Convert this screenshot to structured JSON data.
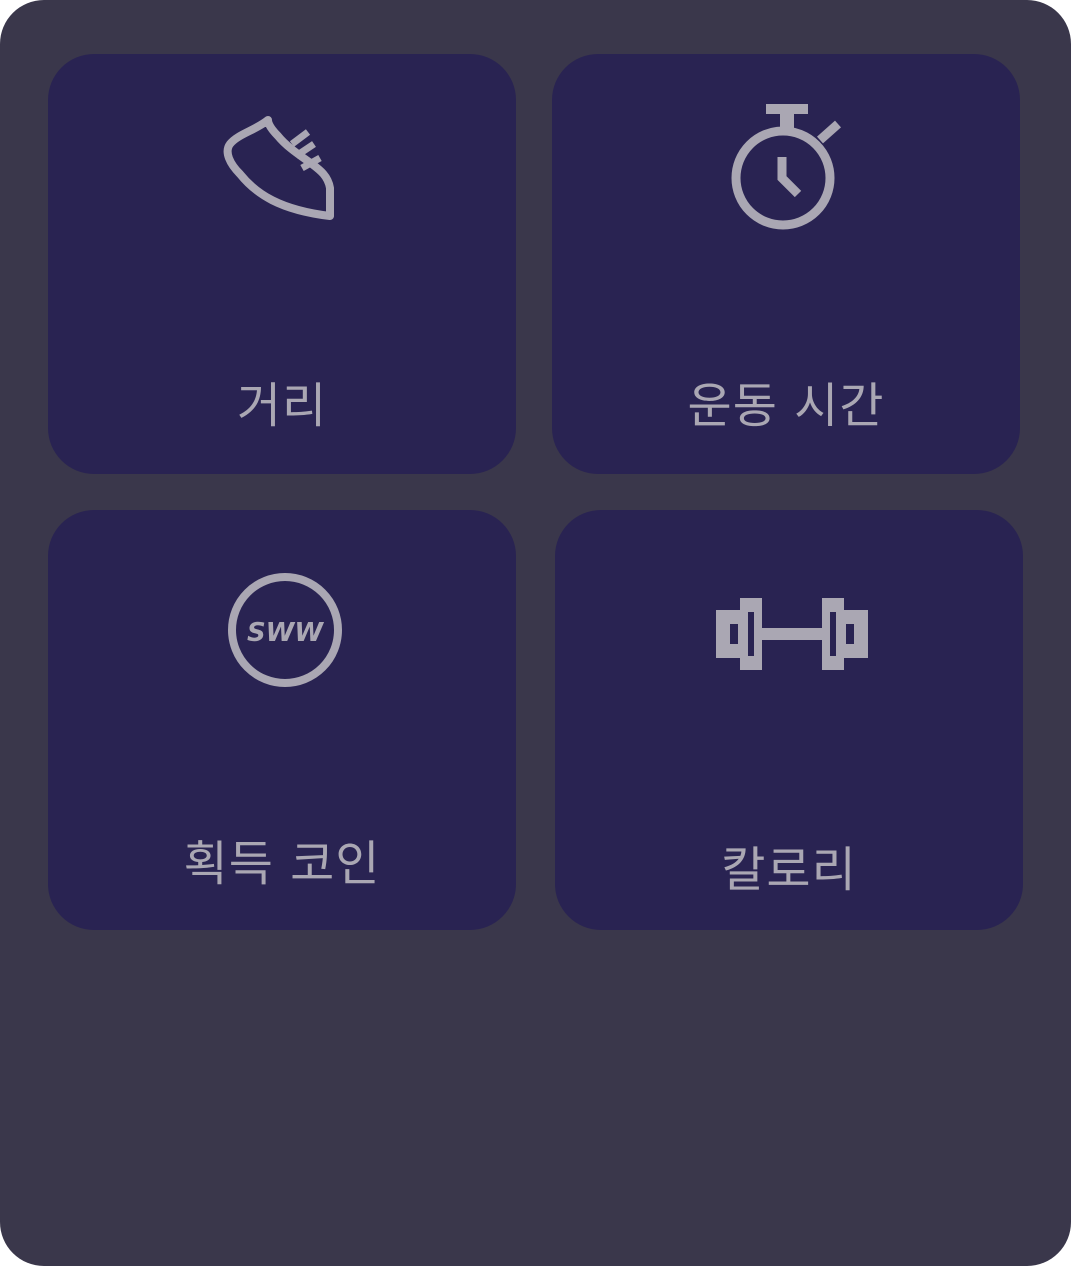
{
  "stats": {
    "distance": {
      "label": "거리",
      "icon": "sneaker-icon"
    },
    "exercise_time": {
      "label": "운동 시간",
      "icon": "stopwatch-icon"
    },
    "earned_coins": {
      "label": "획득 코인",
      "icon": "coin-icon",
      "coin_text": "SWW"
    },
    "calories": {
      "label": "칼로리",
      "icon": "dumbbell-icon"
    }
  },
  "colors": {
    "background": "#3a374b",
    "card": "#292352",
    "foreground": "#aaa7b3"
  }
}
